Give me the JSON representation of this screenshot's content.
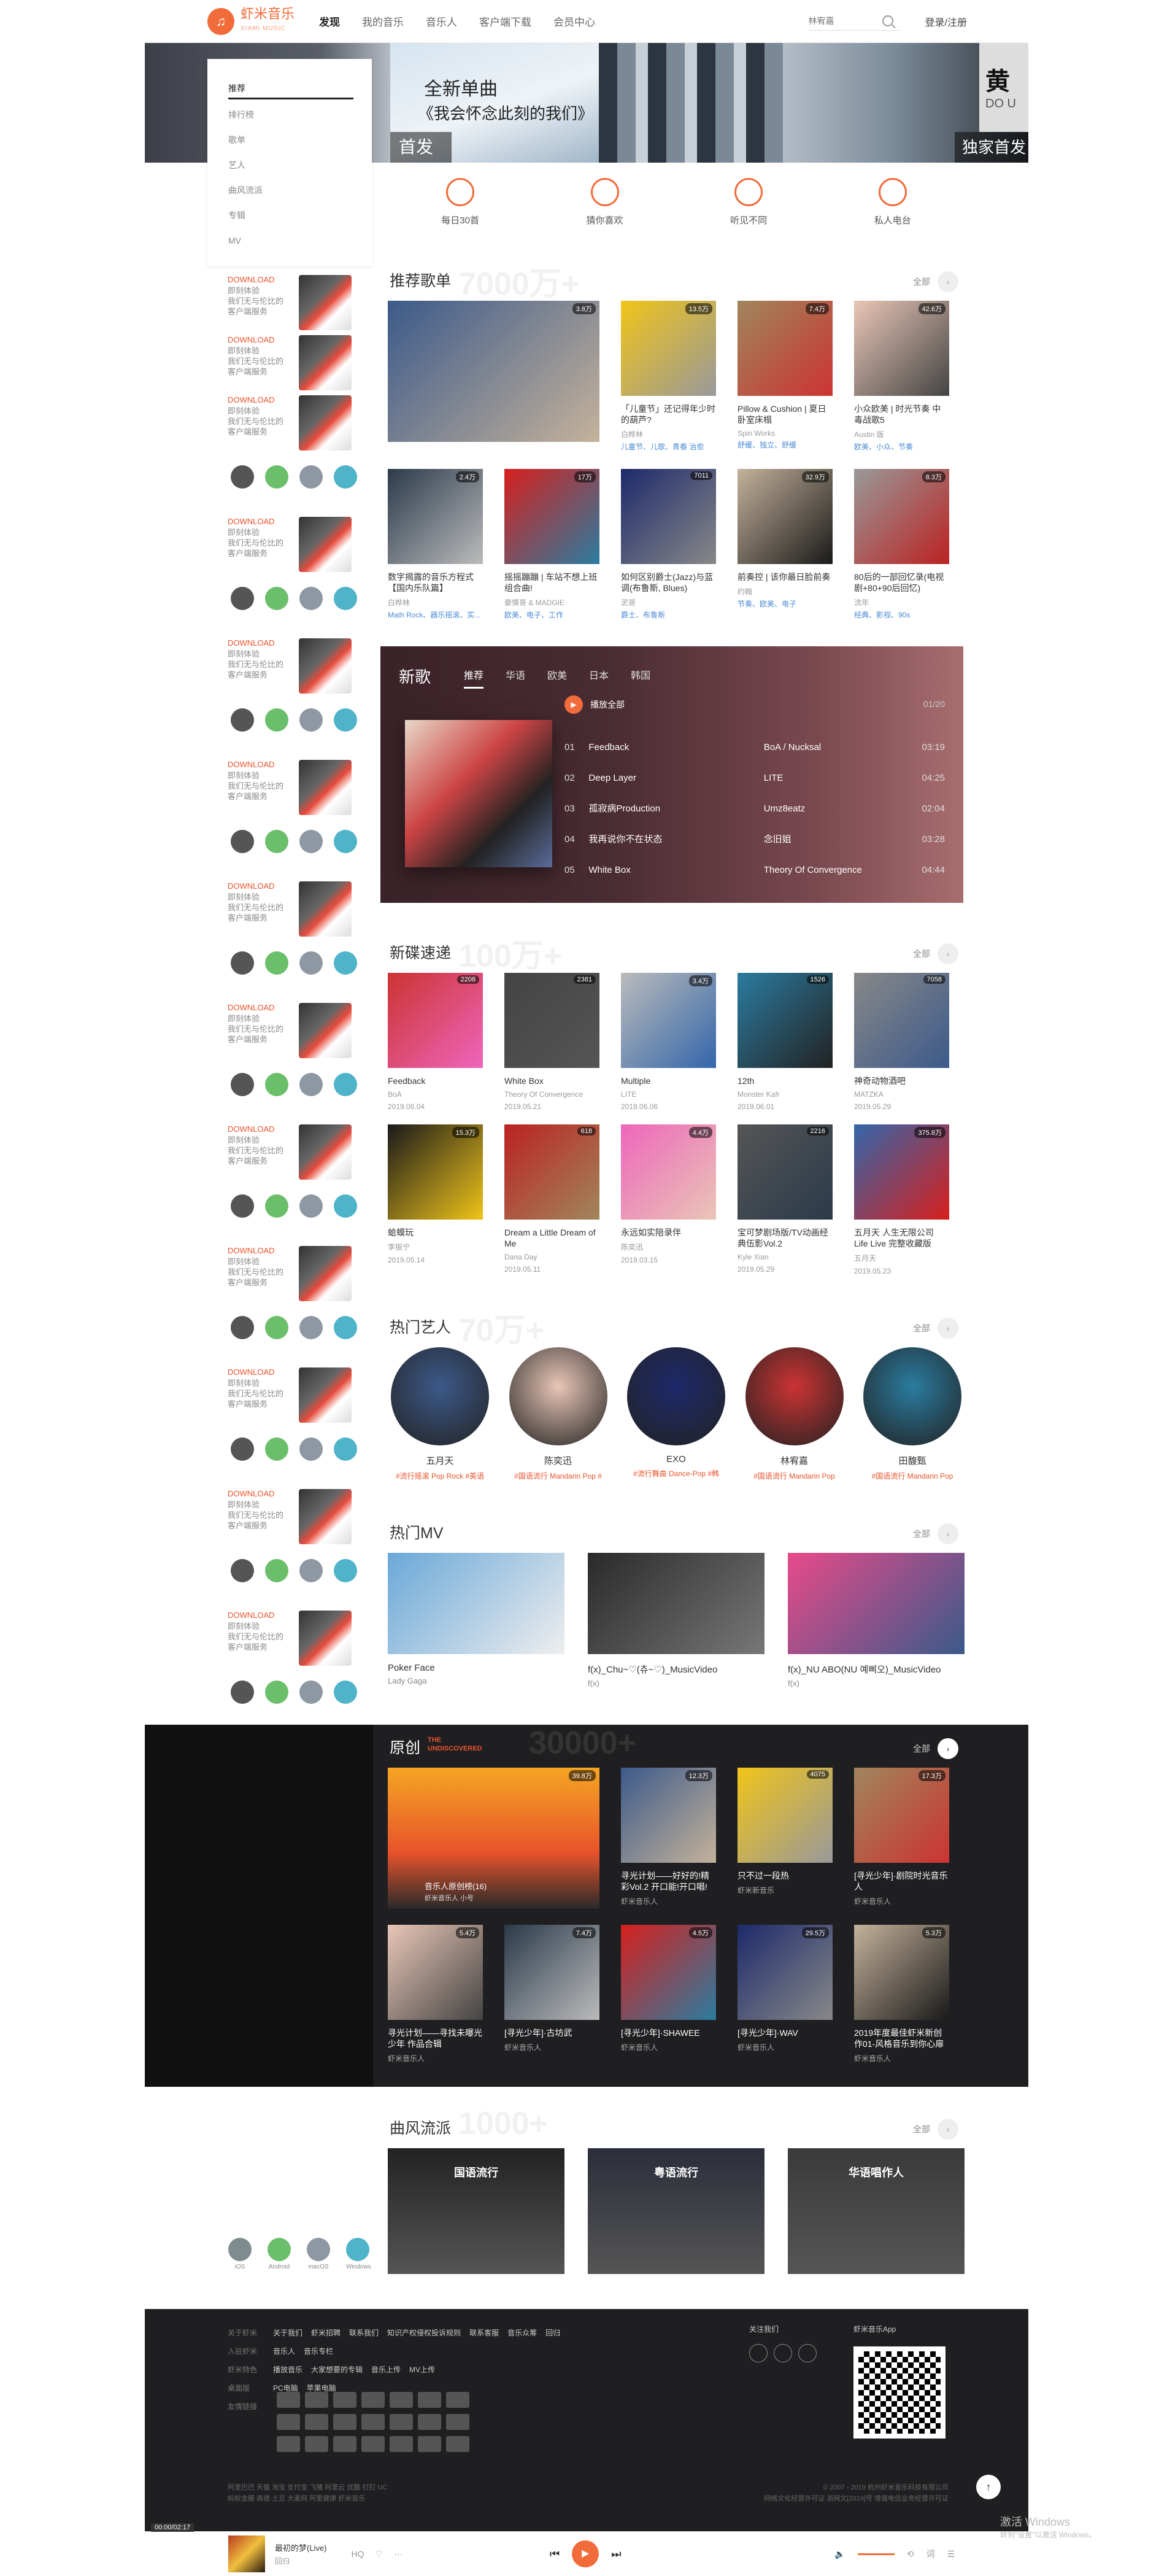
{
  "header": {
    "logo_text": "虾米音乐",
    "logo_sub": "XIAMI MUSIC",
    "nav": [
      "发现",
      "我的音乐",
      "音乐人",
      "客户端下载",
      "会员中心"
    ],
    "search_placeholder": "林宥嘉",
    "login": "登录/注册"
  },
  "banner": {
    "line1": "全新单曲",
    "line2": "《我会怀念此刻的我们》",
    "tab": "首发",
    "tab2": "独家首发",
    "right_big": "黄",
    "right_small": "DO U"
  },
  "left_menu": [
    "推荐",
    "排行榜",
    "歌单",
    "艺人",
    "曲风流派",
    "专辑",
    "MV"
  ],
  "download": {
    "title": "DOWNLOAD",
    "desc1": "即刻体验",
    "desc2": "我们无与伦比的",
    "desc3": "客户端服务"
  },
  "quick": [
    "每日30首",
    "猜你喜欢",
    "听见不同",
    "私人电台"
  ],
  "playlists": {
    "title": "推荐歌单",
    "watermark": "7000万+",
    "more": "全部",
    "big": {
      "name": "",
      "badge": "3.8万"
    },
    "items": [
      {
        "name": "「儿童节」还记得年少时的葫芦?",
        "author": "白桦林",
        "tags": "儿童节、儿歌、青春 治愈",
        "badge": "13.5万"
      },
      {
        "name": "Pillow & Cushion | 夏日卧室床榻",
        "author": "Spin Works",
        "tags": "舒缓、独立、舒缓",
        "badge": "7.4万"
      },
      {
        "name": "小众欧美 | 时光节奏 中毒战歌5",
        "author": "Austin 版",
        "tags": "欧美、小众、节奏",
        "badge": "42.6万"
      },
      {
        "name": "数字揭露的音乐方程式【国内乐队篇】",
        "author": "白桦林",
        "tags": "Math Rock、器乐摇滚、实...",
        "badge": "2.4万"
      },
      {
        "name": "摇摇蹦蹦 | 车站不想上班组合曲!",
        "author": "豪情哥 & MADGIE",
        "tags": "欧美、电子、工作",
        "badge": "17万"
      },
      {
        "name": "如何区别爵士(Jazz)与蓝调(布鲁斯, Blues)",
        "author": "泥哥",
        "tags": "爵士、布鲁斯",
        "badge": "7011"
      },
      {
        "name": "前奏控 | 该你最日脸前奏",
        "author": "约翰",
        "tags": "节奏、欧美、电子",
        "badge": "32.9万"
      },
      {
        "name": "80后的一部回忆录(电视剧+80+90后回忆)",
        "author": "流年",
        "tags": "经典、影视、90s",
        "badge": "8.3万"
      }
    ]
  },
  "newsongs": {
    "title": "新歌",
    "tabs": [
      "推荐",
      "华语",
      "欧美",
      "日本",
      "韩国"
    ],
    "play_all": "播放全部",
    "page": "01/20",
    "rows": [
      {
        "i": "01",
        "t": "Feedback",
        "a": "BoA / Nucksal",
        "d": "03:19"
      },
      {
        "i": "02",
        "t": "Deep Layer",
        "a": "LITE",
        "d": "04:25"
      },
      {
        "i": "03",
        "t": "孤寂病Production",
        "a": "Umz8eatz",
        "d": "02:04"
      },
      {
        "i": "04",
        "t": "我再说你不在状态",
        "a": "念旧姐",
        "d": "03:28"
      },
      {
        "i": "05",
        "t": "White Box",
        "a": "Theory Of Convergence",
        "d": "04:44"
      }
    ]
  },
  "albums": {
    "title": "新碟速递",
    "watermark": "100万+",
    "more": "全部",
    "items": [
      {
        "name": "Feedback",
        "artist": "BoA",
        "date": "2019.06.04",
        "badge": "2208"
      },
      {
        "name": "White Box",
        "artist": "Theory Of Convergence",
        "date": "2019.05.21",
        "badge": "2381"
      },
      {
        "name": "Multiple",
        "artist": "LITE",
        "date": "2019.06.06",
        "badge": "3.4万"
      },
      {
        "name": "12th",
        "artist": "Monster Kafr",
        "date": "2019.06.01",
        "badge": "1526"
      },
      {
        "name": "神奇动物酒吧",
        "artist": "MATZKA",
        "date": "2019.05.29",
        "badge": "7058"
      },
      {
        "name": "蛤蟆玩",
        "artist": "李振宁",
        "date": "2019.05.14",
        "badge": "15.3万"
      },
      {
        "name": "Dream a Little Dream of Me",
        "artist": "Dana Day",
        "date": "2019.05.11",
        "badge": "618"
      },
      {
        "name": "永远如实陪录伴",
        "artist": "陈奕迅",
        "date": "2019.03.15",
        "badge": "4.4万"
      },
      {
        "name": "宝可梦剧场版/TV动画经典伍影Vol.2",
        "artist": "Kyle Xian",
        "date": "2019.05.29",
        "badge": "2216"
      },
      {
        "name": "五月天 人生无限公司 Life Live 完整收藏版",
        "artist": "五月天",
        "date": "2019.05.23",
        "badge": "375.8万"
      }
    ]
  },
  "artists": {
    "title": "热门艺人",
    "watermark": "70万+",
    "more": "全部",
    "items": [
      {
        "name": "五月天",
        "genre": "#流行摇滚 Pop Rock #英语"
      },
      {
        "name": "陈奕迅",
        "genre": "#国语流行 Mandarin Pop #"
      },
      {
        "name": "EXO",
        "genre": "#流行舞曲 Dance-Pop #韩"
      },
      {
        "name": "林宥嘉",
        "genre": "#国语流行 Mandarin Pop"
      },
      {
        "name": "田馥甄",
        "genre": "#国语流行 Mandarin Pop"
      }
    ]
  },
  "mv": {
    "title": "热门MV",
    "more": "全部",
    "items": [
      {
        "name": "Poker Face",
        "artist": "Lady Gaga"
      },
      {
        "name": "f(x)_Chu~♡(츄~♡)_MusicVideo",
        "artist": "f(x)"
      },
      {
        "name": "f(x)_NU ABO(NU 예삐오)_MusicVideo",
        "artist": "f(x)"
      }
    ]
  },
  "original": {
    "title": "原创",
    "sub": "THE UNDISCOVERED",
    "watermark": "30000+",
    "more": "全部",
    "big": {
      "name": "音乐人原创榜(16)",
      "author": "虾米音乐人 小号",
      "badge": "39.8万"
    },
    "items": [
      {
        "name": "寻光计划——好好的!精彩Vol.2 开口能!开口唱!",
        "author": "虾米音乐人",
        "badge": "12.3万"
      },
      {
        "name": "只不过一段热",
        "author": "虾米新音乐",
        "badge": "4075"
      },
      {
        "name": "[寻光少年]·剧院时光音乐人",
        "author": "虾米音乐人",
        "badge": "17.3万"
      },
      {
        "name": "寻光计划——寻找未曝光少年 作品合辑",
        "author": "虾米音乐人",
        "badge": "5.4万"
      },
      {
        "name": "[寻光少年]·古坊武",
        "author": "虾米音乐人",
        "badge": "7.4万"
      },
      {
        "name": "[寻光少年]·SHAWEE",
        "author": "虾米音乐人",
        "badge": "4.5万"
      },
      {
        "name": "[寻光少年]·WAV",
        "author": "虾米音乐人",
        "badge": "29.5万"
      },
      {
        "name": "2019年度最佳虾米新创作01-风格音乐到你心扉",
        "author": "虾米音乐人",
        "badge": "5.3万"
      }
    ]
  },
  "genres": {
    "title": "曲风流派",
    "watermark": "1000+",
    "more": "全部",
    "items": [
      "国语流行",
      "粤语流行",
      "华语唱作人"
    ]
  },
  "stores": [
    "iOS",
    "Android",
    "macOS",
    "Windows"
  ],
  "footer": {
    "rows": [
      {
        "label": "关于虾米",
        "links": [
          "关于我们",
          "虾米招聘",
          "联系我们",
          "知识产权侵权投诉规则",
          "联系客服",
          "音乐众筹",
          "回归"
        ]
      },
      {
        "label": "入驻虾米",
        "links": [
          "音乐人",
          "音乐专栏"
        ]
      },
      {
        "label": "虾米特色",
        "links": [
          "播放音乐",
          "大家想要的专辑",
          "音乐上传",
          "MV上传"
        ]
      },
      {
        "label": "桌面版",
        "links": [
          "PC电脑",
          "苹果电脑"
        ]
      },
      {
        "label": "友情链接",
        "links": []
      }
    ],
    "follow": "关注我们",
    "app": "虾米音乐App",
    "bottom1": "阿里巴巴  天猫  淘宝  支付宝  飞猪  阿里云  优酷  钉钉  UC",
    "bottom2": "蚂蚁金服  高德  土豆  大麦网  阿里健康  虾米音乐",
    "copy1": "© 2007 - 2019 杭州虾米音乐科技有限公司",
    "copy2": "网络文化经营许可证 浙网文[2019]号 增值电信业务经营许可证",
    "top": "↑"
  },
  "player": {
    "time": "00:00/02:17",
    "song": "最初的梦(Live)",
    "artist": "回归",
    "hq": "HQ"
  },
  "watermark": {
    "line1": "激活 Windows",
    "line2": "转到\"设置\"以激活 Windows。"
  }
}
